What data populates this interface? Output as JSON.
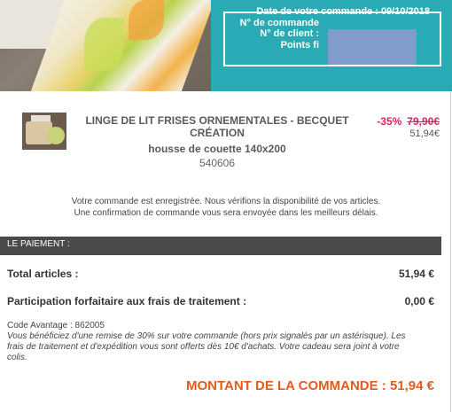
{
  "header": {
    "order_date": "Date de votre commande : 09/10/2018",
    "order_number": "N° de commande",
    "client_number": "N° de client :",
    "points": "Points fi",
    "brand_color": "#2aaab4"
  },
  "product": {
    "name": "LINGE DE LIT FRISES ORNEMENTALES - BECQUET CRÉATION",
    "variant": "housse de couette 140x200",
    "reference": "540606",
    "discount": "-35%",
    "old_price": "79,90€",
    "new_price": "51,94€"
  },
  "message": {
    "line1": "Votre commande est enregistrée. Nous vérifions la disponibilité de vos articles.",
    "line2": "Une confirmation de commande vous sera envoyée dans les meilleurs délais."
  },
  "payment": {
    "title": "LE PAIEMENT :",
    "total_articles_label": "Total articles :",
    "total_articles_value": "51,94 €",
    "fees_label": "Participation forfaitaire aux frais de traitement :",
    "fees_value": "0,00 €",
    "promo_code": "Code Avantage : 862005",
    "promo_note": "Vous bénéficiez d'une remise de 30% sur votre commande (hors prix signalés par un astérisque). Les frais de traitement et d'expédition vous sont offerts dès 10€ d'achats. Votre cadeau sera joint à votre colis.",
    "grand_total": "MONTANT DE LA COMMANDE : 51,94 €"
  }
}
